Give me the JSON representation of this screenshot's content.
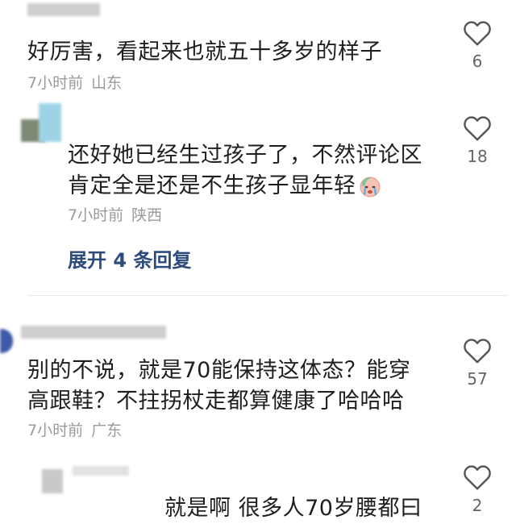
{
  "comments": [
    {
      "text_lines": [
        "好厉害，看起来也就五十多岁的样子"
      ],
      "time": "7小时前",
      "location": "山东",
      "likes": "6"
    },
    {
      "text_lines": [
        "还好她已经生过孩子了，不然评论区",
        "肯定全是还是不生孩子显年轻"
      ],
      "time": "7小时前",
      "location": "陕西",
      "likes": "18",
      "expand_label": "展开 4 条回复"
    },
    {
      "text_lines": [
        "别的不说，就是70能保持这体态？能穿",
        "高跟鞋？不拄拐杖走都算健康了哈哈哈"
      ],
      "time": "7小时前",
      "location": "广东",
      "likes": "57"
    },
    {
      "text_lines": [
        "就是啊 很多人70岁腰都曰"
      ],
      "likes": "2"
    }
  ],
  "icons": {
    "like": "heart-outline-icon",
    "emoji": "crying-face-emoji"
  },
  "colors": {
    "link": "#2c4a7c",
    "meta": "#9a9a9a",
    "text": "#1e1e1e"
  }
}
